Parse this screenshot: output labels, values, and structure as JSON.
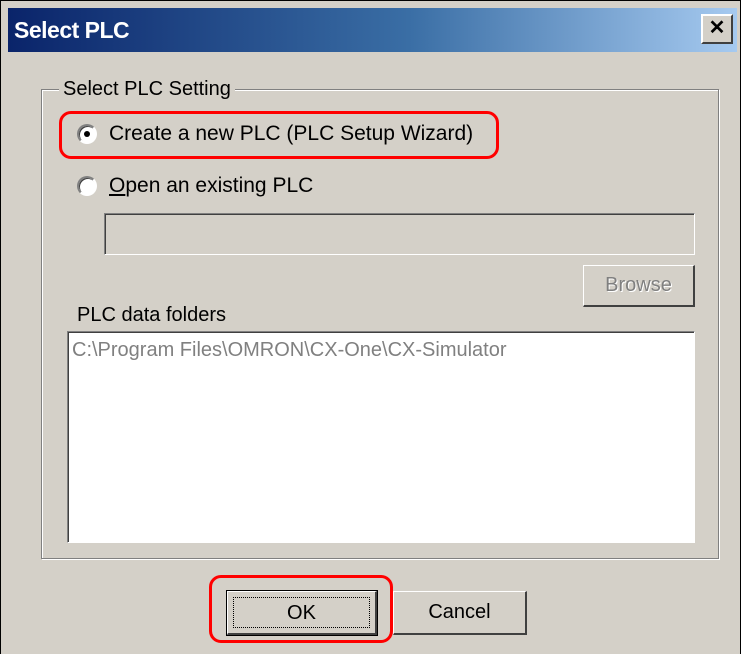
{
  "window": {
    "title": "Select PLC",
    "close_glyph": "✕"
  },
  "group": {
    "legend": "Select PLC Setting"
  },
  "options": {
    "create_new": {
      "label": "Create a new PLC (PLC Setup Wizard)",
      "checked": true
    },
    "open_existing": {
      "label_underlined": "O",
      "label_rest": "pen an existing PLC",
      "checked": false
    }
  },
  "path_field": {
    "value": ""
  },
  "browse": {
    "label": "Browse",
    "enabled": false
  },
  "folders": {
    "label": "PLC data folders",
    "items": [
      "C:\\Program Files\\OMRON\\CX-One\\CX-Simulator"
    ]
  },
  "buttons": {
    "ok": "OK",
    "cancel": "Cancel"
  },
  "annotations": {
    "highlight_color": "#ff0000"
  },
  "colors": {
    "dialog_face": "#d4d0c8",
    "title_gradient_start": "#0a246a",
    "title_gradient_end": "#a6caf0"
  }
}
